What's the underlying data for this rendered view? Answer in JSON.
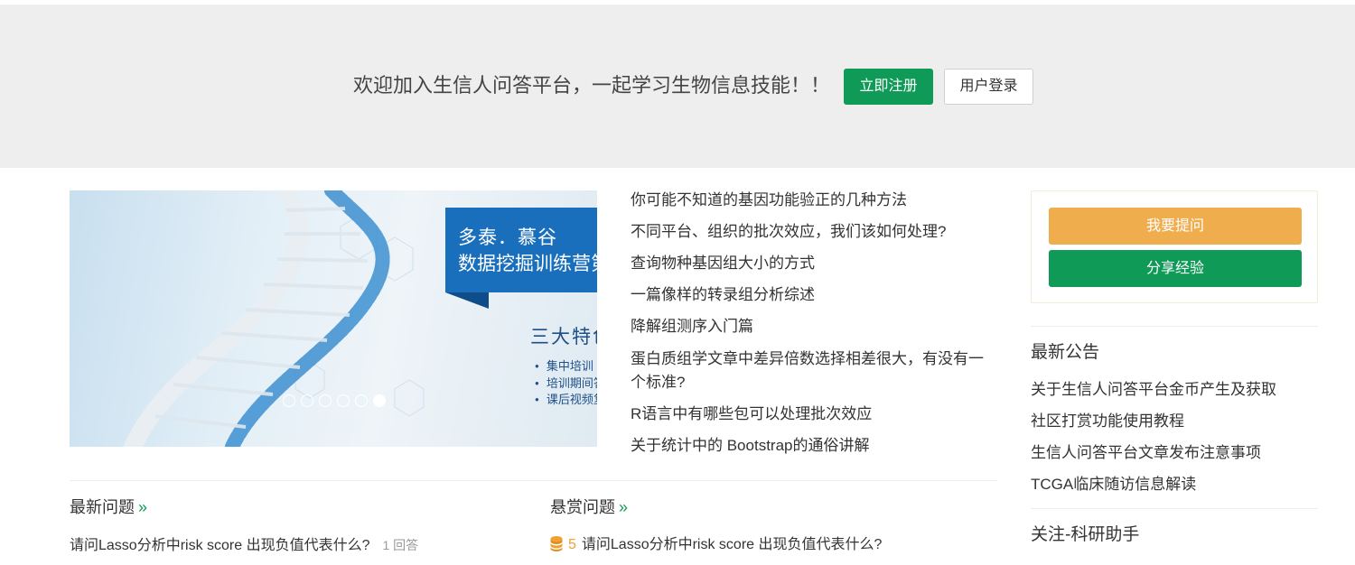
{
  "header": {
    "welcome_text": "欢迎加入生信人问答平台，一起学习生物信息技能！！",
    "register_label": "立即注册",
    "login_label": "用户登录"
  },
  "banner": {
    "line1": "多泰．慕谷",
    "line2": "数据挖掘训练营第二期",
    "feature_title": "三大特色",
    "features": [
      "集中培训",
      "培训期间答疑",
      "课后视频复习"
    ],
    "slide_count": 6,
    "active_slide": 6
  },
  "articles": [
    "你可能不知道的基因功能验正的几种方法",
    "不同平台、组织的批次效应，我们该如何处理?",
    "查询物种基因组大小的方式",
    "一篇像样的转录组分析综述",
    "降解组测序入门篇",
    "蛋白质组学文章中差异倍数选择相差很大，有没有一个标准?",
    "R语言中有哪些包可以处理批次效应",
    "关于统计中的 Bootstrap的通俗讲解"
  ],
  "latest_questions": {
    "title": "最新问题",
    "more": "»",
    "items": [
      {
        "text": "请问Lasso分析中risk score 出现负值代表什么?",
        "count": "1 回答"
      }
    ]
  },
  "reward_questions": {
    "title": "悬赏问题",
    "more": "»",
    "items": [
      {
        "reward": "5",
        "text": "请问Lasso分析中risk score 出现负值代表什么?"
      }
    ]
  },
  "sidebar": {
    "ask_label": "我要提问",
    "share_label": "分享经验",
    "notice_title": "最新公告",
    "notices": [
      "关于生信人问答平台金币产生及获取",
      "社区打赏功能使用教程",
      "生信人问答平台文章发布注意事项",
      "TCGA临床随访信息解读"
    ],
    "follow_title": "关注-科研助手"
  },
  "colors": {
    "primary_green": "#0f9b57",
    "ask_orange": "#f0ad4e",
    "banner_blue": "#1a6fbd",
    "header_bg": "#eeeeee"
  }
}
